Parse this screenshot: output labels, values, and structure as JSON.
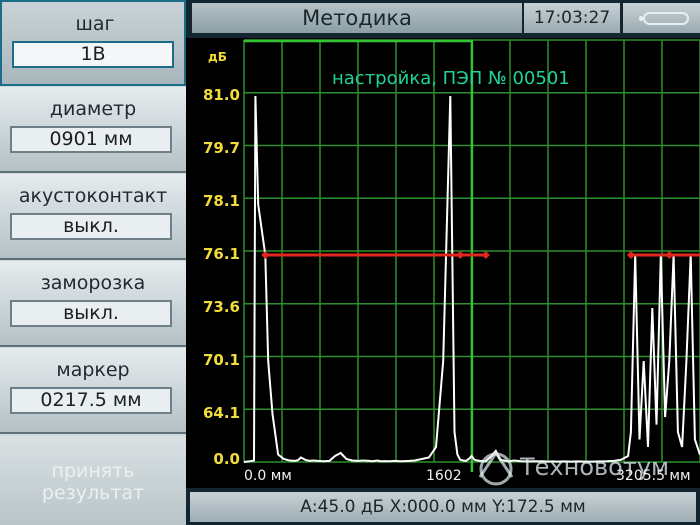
{
  "header": {
    "title": "Методика",
    "clock": "17:03:27"
  },
  "sidebar": {
    "params": [
      {
        "label": "шаг",
        "value": "1В",
        "selected": true
      },
      {
        "label": "диаметр",
        "value": "0901 мм",
        "selected": false
      },
      {
        "label": "акустоконтакт",
        "value": "выкл.",
        "selected": false
      },
      {
        "label": "заморозка",
        "value": "выкл.",
        "selected": false
      },
      {
        "label": "маркер",
        "value": "0217.5 мм",
        "selected": false
      }
    ],
    "accept_line1": "принять",
    "accept_line2": "результат"
  },
  "plot": {
    "unit": "дБ",
    "overlay": "настройка, ПЭП № 00501",
    "y_ticks": [
      "81.0",
      "79.7",
      "78.1",
      "76.1",
      "73.6",
      "70.1",
      "64.1",
      "0.0"
    ],
    "x_left": "0.0 мм",
    "x_mid": "1602",
    "x_right": "3205.5 мм",
    "colors": {
      "grid": "#2e8f2e",
      "gate": "#e0281e",
      "trace": "#ffffff",
      "marker": "#33c433",
      "axis_text": "#f2dc3a",
      "overlay_text": "#1fd39a"
    }
  },
  "chart_data": {
    "type": "line",
    "x_range": [
      0.0,
      3205.5
    ],
    "x_unit": "мм",
    "ylabel": "дБ",
    "y_ticks": [
      81.0,
      79.7,
      78.1,
      76.1,
      73.6,
      70.1,
      64.1,
      0.0
    ],
    "gate_level": 76.1,
    "marker_x": 1602,
    "grid": true,
    "series": [
      {
        "x": [
          0,
          40,
          70,
          80,
          100,
          150,
          170,
          200,
          240,
          280,
          320,
          360,
          380,
          400,
          430,
          460,
          490,
          520,
          560,
          600,
          640,
          680,
          720,
          760,
          800,
          840,
          880,
          900,
          920,
          940,
          960,
          990,
          1020,
          1060,
          1100,
          1130,
          1160,
          1200,
          1250,
          1300,
          1350,
          1400,
          1450,
          1480,
          1500,
          1520,
          1540,
          1560,
          1580,
          1600,
          1620,
          1640,
          1660,
          1700,
          1740,
          1770,
          1800,
          1830,
          1860,
          1900,
          1950,
          2000,
          2040,
          2080,
          2100,
          2140,
          2170,
          2200,
          2250,
          2300,
          2350,
          2400,
          2450,
          2500,
          2550,
          2600,
          2650,
          2700,
          2720,
          2750,
          2780,
          2810,
          2840,
          2870,
          2900,
          2930,
          2960,
          2990,
          3020,
          3050,
          3080,
          3110,
          3140,
          3170,
          3205
        ],
        "y": [
          0.0,
          1.0,
          2.0,
          81.0,
          78.0,
          76.1,
          70.1,
          64.1,
          10.0,
          4.0,
          2.0,
          1.5,
          2.5,
          6.0,
          3.0,
          1.5,
          2.0,
          1.5,
          1.0,
          1.5,
          8.0,
          12.0,
          4.0,
          2.0,
          1.5,
          2.0,
          1.5,
          1.0,
          1.5,
          2.0,
          1.0,
          1.2,
          1.0,
          1.5,
          1.0,
          1.2,
          1.5,
          2.0,
          4.0,
          6.0,
          20.0,
          70.1,
          81.0,
          40.0,
          10.0,
          3.0,
          2.0,
          1.5,
          4.0,
          8.0,
          3.0,
          2.0,
          1.5,
          1.0,
          8.0,
          15.0,
          3.0,
          2.0,
          1.0,
          2.0,
          1.0,
          0.8,
          1.0,
          0.8,
          1.0,
          0.6,
          0.8,
          0.6,
          0.8,
          0.6,
          0.8,
          0.5,
          0.6,
          0.8,
          1.0,
          1.5,
          3.0,
          8.0,
          40.0,
          76.1,
          30.0,
          70.1,
          20.0,
          73.6,
          50.0,
          76.1,
          60.0,
          70.1,
          76.1,
          40.0,
          20.0,
          70.1,
          76.1,
          30.0,
          10.0
        ]
      }
    ]
  },
  "status": {
    "text": "А:45.0 дБ X:000.0 мм Y:172.5 мм"
  },
  "watermark": {
    "text": "Техновотум"
  }
}
